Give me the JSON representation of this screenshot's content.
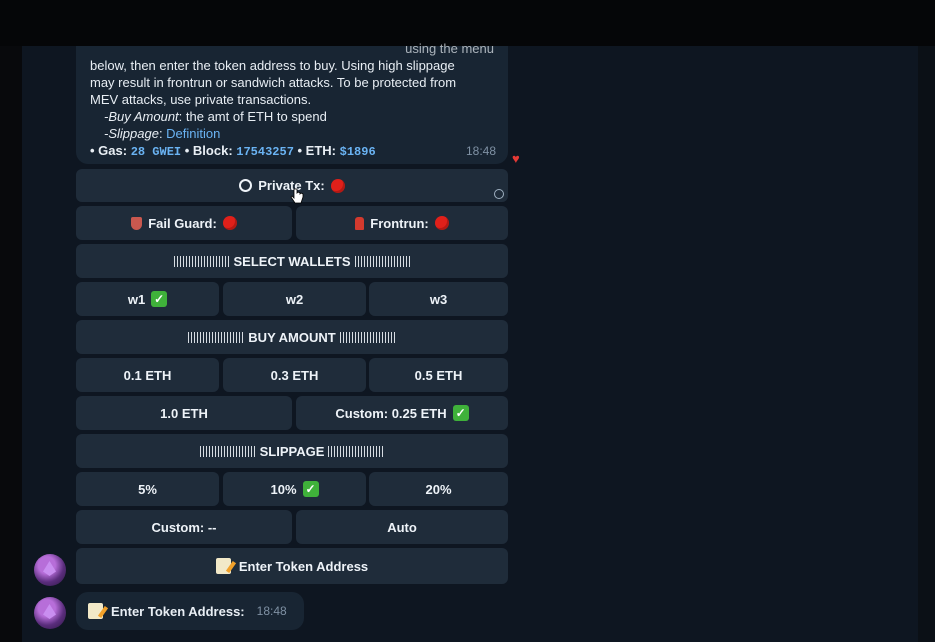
{
  "message": {
    "lines": [
      "using the menu",
      "below, then enter the token address to buy. Using high slippage",
      "may result in frontrun or sandwich attacks. To be protected from",
      "MEV attacks, use private transactions."
    ],
    "buy_amount_label": "-Buy Amount",
    "buy_amount_desc": ": the amt of ETH to spend",
    "slippage_label": "-Slippage",
    "slippage_sep": ": ",
    "slippage_link": "Definition",
    "gas_label": "• Gas:",
    "gas_value": "28 GWEI",
    "block_label": "• Block:",
    "block_value": "17543257",
    "eth_label": "• ETH:",
    "eth_value": "$1896",
    "time": "18:48",
    "reaction_icon": "heart-icon",
    "reaction": "♥"
  },
  "keyboard": {
    "private_tx": "Private Tx:",
    "fail_guard": "Fail Guard:",
    "frontrun": "Frontrun:",
    "select_wallets": "SELECT WALLETS",
    "wallets": [
      "w1",
      "w2",
      "w3"
    ],
    "buy_amount": "BUY AMOUNT",
    "amounts": [
      "0.1 ETH",
      "0.3 ETH",
      "0.5 ETH",
      "1.0 ETH",
      "Custom: 0.25 ETH"
    ],
    "slippage": "SLIPPAGE",
    "slippages": [
      "5%",
      "10%",
      "20%",
      "Custom: --",
      "Auto"
    ],
    "enter_token": "Enter Token Address",
    "check_symbol": "✓",
    "status_color": "#e0201a",
    "check_color": "#3fb13a"
  },
  "reply": {
    "text": "Enter Token Address:",
    "time": "18:48"
  }
}
